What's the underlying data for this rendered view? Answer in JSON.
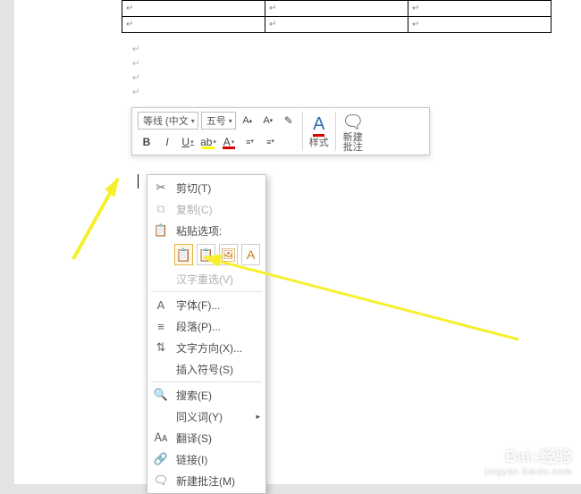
{
  "mini_toolbar": {
    "font_combo": "等线 (中文",
    "size_combo": "五号",
    "grow_font": "A",
    "shrink_font": "A",
    "format_painter": "✎",
    "bold": "B",
    "italic": "I",
    "underline": "U",
    "highlight": "ab",
    "font_color": "A",
    "styles_label": "样式",
    "new_comment_label": "新建\n批注"
  },
  "context_menu": {
    "cut": "剪切(T)",
    "copy": "复制(C)",
    "paste_options_label": "粘贴选项:",
    "hanzi_reselect": "汉字重选(V)",
    "font": "字体(F)...",
    "paragraph": "段落(P)...",
    "text_direction": "文字方向(X)...",
    "insert_symbol": "插入符号(S)",
    "search": "搜索(E)",
    "synonyms": "同义词(Y)",
    "translate": "翻译(S)",
    "link": "链接(I)",
    "new_comment": "新建批注(M)"
  },
  "watermark": {
    "brand": "Bai⌂经验",
    "sub": "jingyan.baidu.com"
  }
}
